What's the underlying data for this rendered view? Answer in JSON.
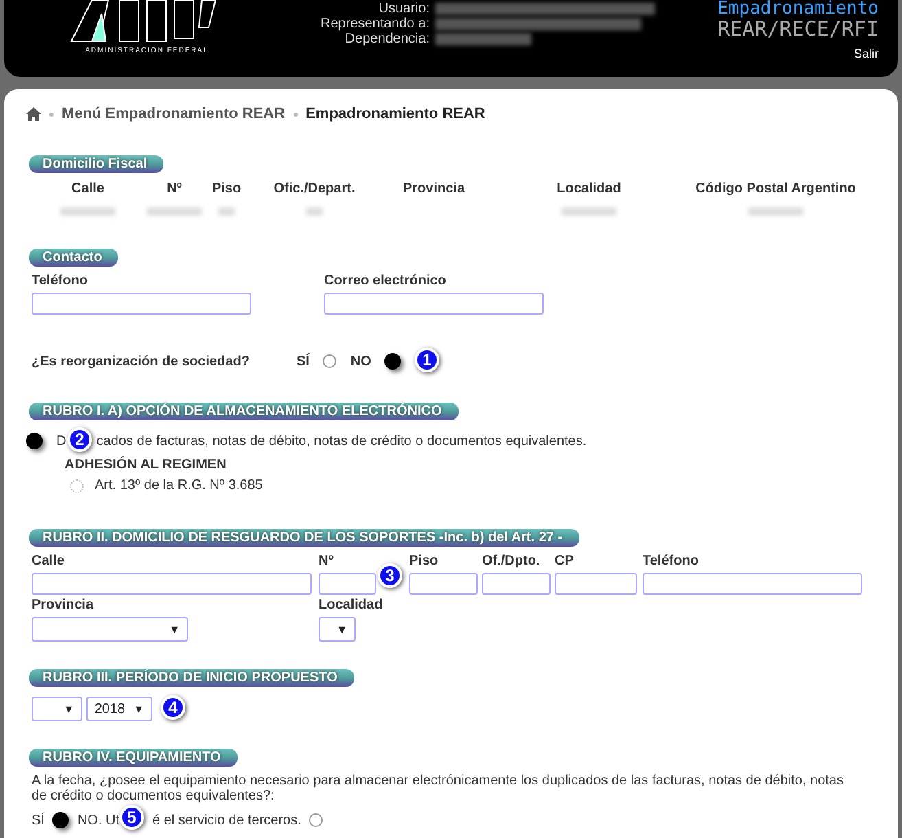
{
  "header": {
    "logo_caption": "ADMINISTRACION FEDERAL",
    "user_labels": [
      "Usuario:",
      "Representando a:",
      "Dependencia:"
    ],
    "app_title": "Empadronamiento",
    "app_subtitle": "REAR/RECE/RFI",
    "logout": "Salir"
  },
  "breadcrumb": [
    "Menú Empadronamiento REAR",
    "Empadronamiento REAR"
  ],
  "domicilio_fiscal": {
    "title": "Domicilio Fiscal",
    "columns": [
      "Calle",
      "Nº",
      "Piso",
      "Ofic./Depart.",
      "Provincia",
      "Localidad",
      "Código Postal Argentino"
    ]
  },
  "contacto": {
    "title": "Contacto",
    "fields": [
      "Teléfono",
      "Correo electrónico"
    ]
  },
  "reorganizacion": {
    "question": "¿Es reorganización de sociedad?",
    "options": [
      {
        "label": "SÍ",
        "selected": false
      },
      {
        "label": "NO",
        "selected": true
      }
    ],
    "callout": "1"
  },
  "rubro_1": {
    "title": "RUBRO I. A) OPCIÓN DE ALMACENAMIENTO ELECTRÓNICO",
    "option": {
      "selected": true,
      "text_before": "D",
      "text_after": "cados de facturas, notas de débito, notas de crédito o documentos equivalentes."
    },
    "callout": "2",
    "subheading": "ADHESIÓN AL REGIMEN",
    "sub_option": {
      "label": "Art. 13º de la R.G. Nº 3.685",
      "disabled": true
    }
  },
  "rubro_2": {
    "title": "RUBRO II. DOMICILIO DE RESGUARDO DE LOS SOPORTES -Inc. b) del Art. 27 -",
    "fields": [
      "Calle",
      "Nº",
      "Piso",
      "Of./Dpto.",
      "CP",
      "Teléfono"
    ],
    "selects": [
      {
        "label": "Provincia",
        "caret": "▼"
      },
      {
        "label": "Localidad",
        "caret": "▼"
      }
    ],
    "callout": "3"
  },
  "rubro_3": {
    "title": "RUBRO III. PERÍODO DE INICIO PROPUESTO",
    "selects": [
      {
        "caret": "▼"
      },
      {
        "value": "2018",
        "caret": "▼"
      }
    ],
    "callout": "4"
  },
  "rubro_4": {
    "title": "RUBRO IV. EQUIPAMIENTO",
    "question": "A la fecha, ¿posee el equipamiento necesario para almacenar electrónicamente los duplicados de las facturas, notas de débito, notas de crédito o documentos equivalentes?:",
    "options": [
      {
        "label": "SÍ",
        "selected": true
      },
      {
        "label": "NO. Ut",
        "label_after": "é el servicio de terceros.",
        "selected": false
      }
    ],
    "callout": "5"
  }
}
